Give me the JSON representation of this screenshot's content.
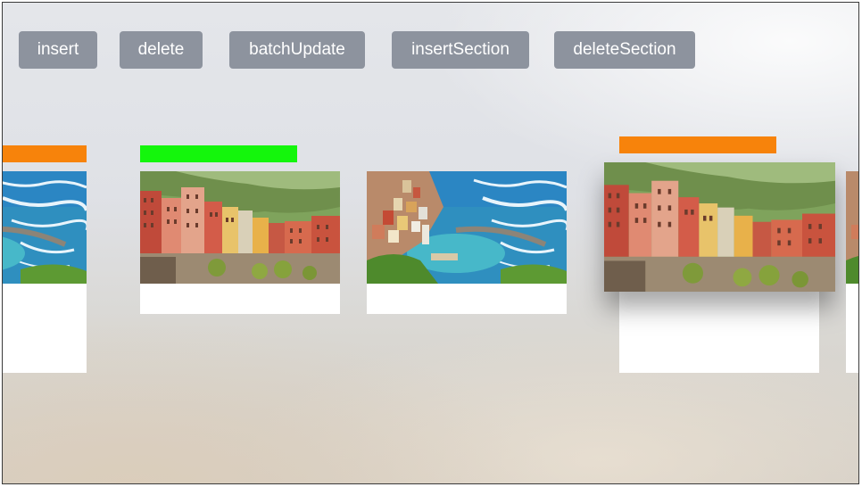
{
  "toolbar": {
    "buttons": [
      {
        "label": "insert"
      },
      {
        "label": "delete"
      },
      {
        "label": "batchUpdate"
      },
      {
        "label": "insertSection"
      },
      {
        "label": "deleteSection"
      }
    ]
  },
  "colors": {
    "button_bg": "#8d939e",
    "button_text": "#ffffff",
    "indicator_orange": "#f7830b",
    "indicator_green": "#14f60c",
    "card_bg": "#ffffff"
  },
  "collection": {
    "cells": [
      {
        "photo": "harbor-photo",
        "indicator_color": "orange",
        "state": "partially-visible"
      },
      {
        "photo": "town-photo",
        "indicator_color": "green",
        "state": "normal"
      },
      {
        "photo": "harbor-photo",
        "indicator_color": "none",
        "state": "normal"
      },
      {
        "photo": "town-photo",
        "indicator_color": "orange",
        "state": "focused"
      },
      {
        "photo": "harbor-photo",
        "indicator_color": "none",
        "state": "partially-visible"
      }
    ]
  }
}
